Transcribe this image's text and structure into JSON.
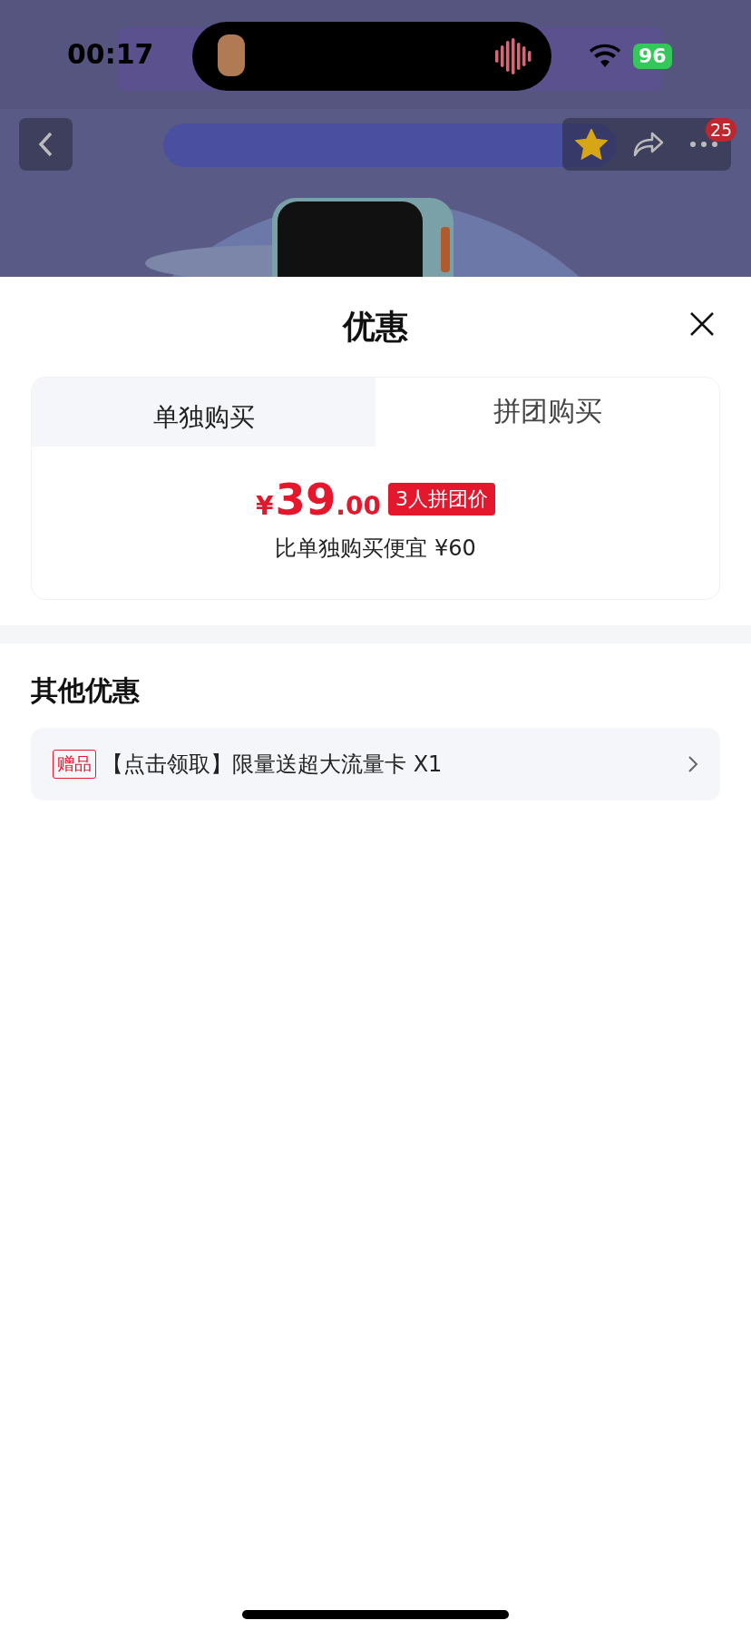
{
  "status_bar": {
    "time": "00:17",
    "battery": "96"
  },
  "nav": {
    "badge": "25",
    "favorite": true
  },
  "sheet": {
    "title": "优惠",
    "tabs": [
      {
        "label": "单独购买",
        "selected": false
      },
      {
        "label": "拼团购买",
        "selected": true
      }
    ],
    "price": {
      "currency": "¥",
      "integer": "39",
      "decimal": ".00",
      "tag": "3人拼团价",
      "note": "比单独购买便宜 ¥60"
    },
    "other": {
      "title": "其他优惠",
      "items": [
        {
          "tag": "赠品",
          "text": "【点击领取】限量送超大流量卡 X1"
        }
      ]
    }
  }
}
